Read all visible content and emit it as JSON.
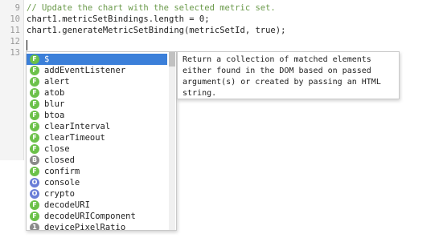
{
  "editor": {
    "lines": [
      {
        "num": "9",
        "text": "// Update the chart with the selected metric set.",
        "comment": true
      },
      {
        "num": "10",
        "text": "chart1.metricSetBindings.length = 0;",
        "comment": false
      },
      {
        "num": "11",
        "text": "chart1.generateMetricSetBinding(metricSetId, true);",
        "comment": false
      },
      {
        "num": "12",
        "text": "",
        "comment": false
      },
      {
        "num": "13",
        "text": "",
        "comment": false
      }
    ]
  },
  "autocomplete": {
    "items": [
      {
        "badge": "F",
        "label": "$",
        "selected": true
      },
      {
        "badge": "F",
        "label": "addEventListener"
      },
      {
        "badge": "F",
        "label": "alert"
      },
      {
        "badge": "F",
        "label": "atob"
      },
      {
        "badge": "F",
        "label": "blur"
      },
      {
        "badge": "F",
        "label": "btoa"
      },
      {
        "badge": "F",
        "label": "clearInterval"
      },
      {
        "badge": "F",
        "label": "clearTimeout"
      },
      {
        "badge": "F",
        "label": "close"
      },
      {
        "badge": "B",
        "label": "closed"
      },
      {
        "badge": "F",
        "label": "confirm"
      },
      {
        "badge": "O",
        "label": "console"
      },
      {
        "badge": "O",
        "label": "crypto"
      },
      {
        "badge": "F",
        "label": "decodeURI"
      },
      {
        "badge": "F",
        "label": "decodeURIComponent"
      },
      {
        "badge": "1",
        "label": "devicePixelRatio"
      }
    ],
    "badge_colors": {
      "F": "#6cc14a",
      "B": "#8a8a8a",
      "O": "#6a7ed8",
      "1": "#8a8a8a"
    }
  },
  "tooltip": {
    "text": "Return a collection of matched elements either found in the DOM based on passed argument(s) or created by passing an HTML string."
  }
}
